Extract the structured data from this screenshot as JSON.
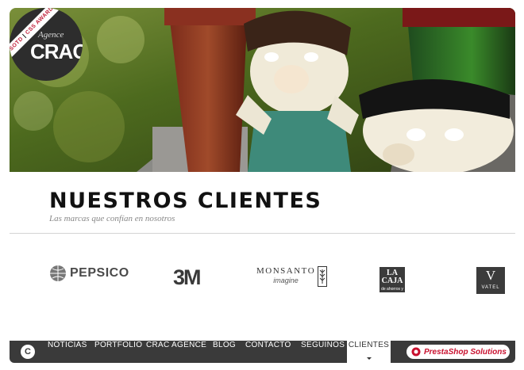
{
  "badge": {
    "ribbon_left": "SOTD",
    "ribbon_sep": " | ",
    "ribbon_right": "CSS AWARDS",
    "agence": "Agence",
    "logo": "CRAC"
  },
  "section": {
    "title": "NUESTROS CLIENTES",
    "subtitle": "Las marcas que confían en nosotros"
  },
  "clients": {
    "pepsico": "PEPSICO",
    "m3": "3M",
    "monsanto_name": "MONSANTO",
    "monsanto_tag": "imagine",
    "lacaja_top": "LA CAJA",
    "lacaja_sub": "de ahorros y seguros",
    "vatel_letter": "V",
    "vatel_name": "VATEL"
  },
  "nav": {
    "home_glyph": "C",
    "items": [
      "NOTICIAS",
      "PORTFOLIO",
      "CRAC AGENCE",
      "BLOG",
      "CONTACTO",
      "SEGUINOS",
      "CLIENTES"
    ],
    "active": "CLIENTES",
    "presta": "PrestaShop Solutions"
  },
  "colors": {
    "nav_bg": "#3a3a3a",
    "badge_bg": "#2d2d2d",
    "accent_red": "#c8102e"
  }
}
